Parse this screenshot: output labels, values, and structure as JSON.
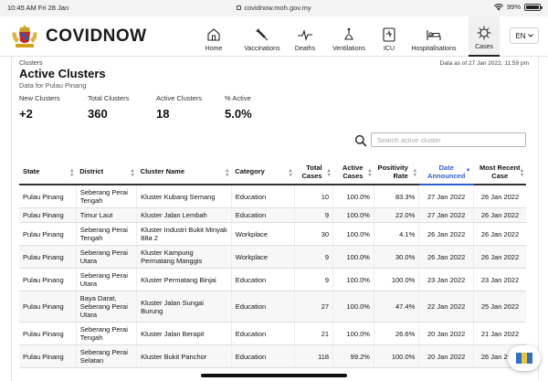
{
  "status_bar": {
    "time": "10:45 AM  Fri 28 Jan",
    "url": "covidnow.moh.gov.my",
    "battery": "99%"
  },
  "brand": {
    "name": "COVIDNOW"
  },
  "nav": [
    {
      "label": "Home",
      "icon": "home-icon"
    },
    {
      "label": "Vaccinations",
      "icon": "syringe-icon"
    },
    {
      "label": "Deaths",
      "icon": "pulse-icon"
    },
    {
      "label": "Ventilations",
      "icon": "ventilator-icon"
    },
    {
      "label": "ICU",
      "icon": "icu-icon"
    },
    {
      "label": "Hospitalisations",
      "icon": "hospital-bed-icon"
    },
    {
      "label": "Cases",
      "icon": "virus-icon"
    }
  ],
  "language": {
    "selected": "EN"
  },
  "page": {
    "breadcrumb": "Clusters",
    "title": "Active Clusters",
    "subtitle": "Data for Pulau Pinang",
    "as_of": "Data as of 27 Jan 2022, 11:59 pm"
  },
  "stats": [
    {
      "label": "New Clusters",
      "value": "+2"
    },
    {
      "label": "Total Clusters",
      "value": "360"
    },
    {
      "label": "Active Clusters",
      "value": "18"
    },
    {
      "label": "% Active",
      "value": "5.0%"
    }
  ],
  "search": {
    "placeholder": "Search active cluster"
  },
  "table": {
    "columns": [
      {
        "label": "State",
        "sort": true
      },
      {
        "label": "District",
        "sort": true
      },
      {
        "label": "Cluster Name",
        "sort": true
      },
      {
        "label": "Category",
        "sort": true
      },
      {
        "label": "Total Cases",
        "sort": true
      },
      {
        "label": "Active Cases",
        "sort": true
      },
      {
        "label": "Positivity Rate",
        "sort": true
      },
      {
        "label": "Date Announced",
        "sort": true,
        "sorted": true
      },
      {
        "label": "Most Recent Case",
        "sort": true
      }
    ],
    "rows": [
      [
        "Pulau Pinang",
        "Seberang Perai Tengah",
        "Kluster Kubang Semang",
        "Education",
        "10",
        "100.0%",
        "83.3%",
        "27 Jan 2022",
        "26 Jan 2022"
      ],
      [
        "Pulau Pinang",
        "Timur Laut",
        "Kluster Jalan Lembah",
        "Education",
        "9",
        "100.0%",
        "22.0%",
        "27 Jan 2022",
        "26 Jan 2022"
      ],
      [
        "Pulau Pinang",
        "Seberang Perai Tengah",
        "Kluster Industri Bukit Minyak 88a 2",
        "Workplace",
        "30",
        "100.0%",
        "4.1%",
        "26 Jan 2022",
        "26 Jan 2022"
      ],
      [
        "Pulau Pinang",
        "Seberang Perai Utara",
        "Kluster Kampung Permatang Manggis",
        "Workplace",
        "9",
        "100.0%",
        "30.0%",
        "26 Jan 2022",
        "26 Jan 2022"
      ],
      [
        "Pulau Pinang",
        "Seberang Perai Utara",
        "Kluster Permatang Binjai",
        "Education",
        "9",
        "100.0%",
        "100.0%",
        "23 Jan 2022",
        "23 Jan 2022"
      ],
      [
        "Pulau Pinang",
        "Baya Darat, Seberang Perai Utara",
        "Kluster Jalan Sungai Burung",
        "Education",
        "27",
        "100.0%",
        "47.4%",
        "22 Jan 2022",
        "25 Jan 2022"
      ],
      [
        "Pulau Pinang",
        "Seberang Perai Tengah",
        "Kluster Jalan Berapit",
        "Education",
        "21",
        "100.0%",
        "26.6%",
        "20 Jan 2022",
        "21 Jan 2022"
      ],
      [
        "Pulau Pinang",
        "Seberang Perai Selatan",
        "Kluster Bukit Panchor",
        "Education",
        "118",
        "99.2%",
        "100.0%",
        "20 Jan 2022",
        "26 Jan 2022"
      ]
    ]
  },
  "colors": {
    "sorted_header": "#2f5fcf"
  }
}
